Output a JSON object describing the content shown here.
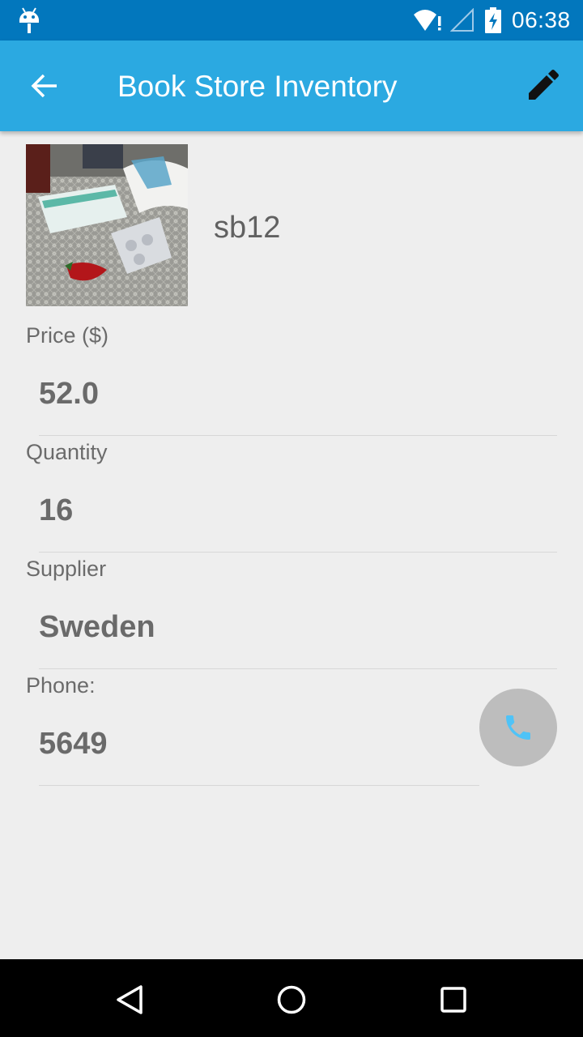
{
  "status_bar": {
    "time": "06:38",
    "icons": [
      "android-icon",
      "wifi-icon",
      "signal-icon",
      "battery-charging-icon"
    ]
  },
  "app_bar": {
    "title": "Book Store Inventory",
    "back_icon": "arrow-back-icon",
    "edit_icon": "pencil-icon",
    "color": "#2ba9e1"
  },
  "product": {
    "name": "sb12",
    "fields": [
      {
        "label": "Price ($)",
        "value": "52.0"
      },
      {
        "label": "Quantity",
        "value": "16"
      },
      {
        "label": "Supplier",
        "value": "Sweden"
      },
      {
        "label": "Phone:",
        "value": "5649"
      }
    ]
  },
  "call_button": {
    "icon": "phone-icon",
    "icon_color": "#4fc3f7"
  },
  "nav_bar": {
    "icons": [
      "back-triangle-icon",
      "home-circle-icon",
      "recents-square-icon"
    ]
  },
  "colors": {
    "status_bar": "#0277bd",
    "background": "#eeeeee",
    "text_value": "#6a6a6a"
  }
}
